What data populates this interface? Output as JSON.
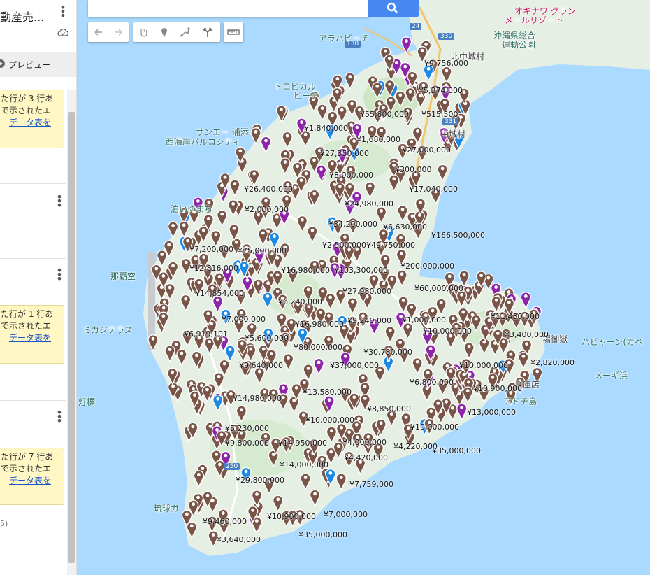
{
  "panel": {
    "title": "動産売...",
    "preview_label": "プレビュー",
    "warnings": [
      {
        "lines": [
          "た行が 3 行あ",
          "で示されたエ"
        ],
        "link": "データ表を"
      },
      {
        "lines": [
          "た行が 1 行あ",
          "で示されたエ"
        ],
        "link": "データ表を"
      },
      {
        "lines": [
          "た行が 7 行あ",
          "で示されたエ"
        ],
        "link": "データ表を"
      }
    ],
    "footer_fragment": "5)"
  },
  "search": {
    "placeholder": ""
  },
  "toolbar": {
    "icons": [
      "undo-icon",
      "redo-icon",
      "hand-icon",
      "marker-icon",
      "line-icon",
      "route-icon",
      "ruler-icon"
    ]
  },
  "map": {
    "place_labels": [
      {
        "text": "アラハビーチ",
        "kind": "place"
      },
      {
        "text": "トロピカル",
        "kind": "place"
      },
      {
        "text": "ビーチ",
        "kind": "place"
      },
      {
        "text": "サンエー 浦添",
        "kind": "place"
      },
      {
        "text": "西海岸パルコシティ",
        "kind": "place"
      },
      {
        "text": "泊いゆまち",
        "kind": "place"
      },
      {
        "text": "那覇空",
        "kind": "place"
      },
      {
        "text": "ミカジテラス",
        "kind": "place"
      },
      {
        "text": "灯標",
        "kind": "place"
      },
      {
        "text": "琉球ガ",
        "kind": "place"
      },
      {
        "text": "北中城村",
        "kind": "dark"
      },
      {
        "text": "中城村",
        "kind": "dark"
      },
      {
        "text": "沖縄県総合",
        "kind": "place"
      },
      {
        "text": "運動公園",
        "kind": "place"
      },
      {
        "text": "オキナワ グラン",
        "kind": "pink"
      },
      {
        "text": "メールリゾート",
        "kind": "pink"
      },
      {
        "text": "ハビャーン(カベ",
        "kind": "place"
      },
      {
        "text": "メーギ浜",
        "kind": "place"
      },
      {
        "text": "アドチ島",
        "kind": "place"
      },
      {
        "text": "倉庫店",
        "kind": "dark"
      },
      {
        "text": "場御嶽",
        "kind": "dark"
      }
    ],
    "road_numbers": [
      "24",
      "330",
      "331",
      "130",
      "250"
    ],
    "prices": [
      "¥9,756,000",
      "¥5,374,000",
      "¥55,800,000",
      "¥515,500",
      "¥1,840,000",
      "¥1,680,000",
      "¥27,000,000",
      "¥27,350,000",
      "¥8,000,000",
      "¥300,000",
      "¥26,400,000",
      "¥17,040,000",
      "¥24,980,000",
      "¥2,000,000",
      "¥34,200,000",
      "¥6,630,000",
      "¥166,500,000",
      "¥7,200,000",
      "¥75,000,000",
      "¥2,500,000",
      "¥49,750,000",
      "¥200,000,000",
      "¥12,816,000",
      "¥16,980,000",
      "¥103,300,000",
      "¥60,000,000",
      "¥14,854,000",
      "¥27,980,000",
      "¥6,240,000",
      "¥11,430,000",
      "¥7,000,000",
      "¥16,980,000",
      "¥9,240,000",
      "¥1,000,000",
      "¥10,000,000",
      "¥3,400,000",
      "¥6,919,101",
      "¥5,600,000",
      "¥80,000,000",
      "¥30,780,000",
      "¥9,640,000",
      "¥37,000,000",
      "¥10,000,000",
      "¥2,820,000",
      "¥6,800,000",
      "¥10,900,000",
      "¥13,580,000",
      "¥14,980,000",
      "¥8,850,000",
      "¥13,000,000",
      "¥10,000,000",
      "¥5,230,000",
      "¥19,000,000",
      "¥9,800,000",
      "¥14,950,000",
      "¥4,000,000",
      "¥4,220,000",
      "¥35,000,000",
      "¥4,420,000",
      "¥14,000,000",
      "¥29,800,000",
      "¥7,759,000",
      "¥10,900,000",
      "¥7,000,000",
      "¥9,460,000",
      "¥35,000,000",
      "¥3,640,000"
    ]
  },
  "colors": {
    "sea": "#aadaff",
    "land": "#e6efe4",
    "pin": "#795548",
    "purple_marker": "#8e24aa",
    "blue_marker": "#1e88e5",
    "search_button": "#4688f2"
  }
}
